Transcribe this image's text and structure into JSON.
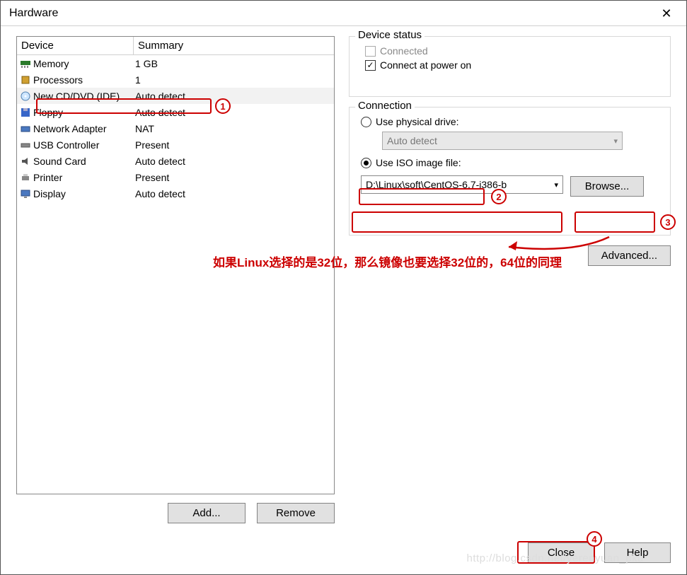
{
  "window": {
    "title": "Hardware"
  },
  "device_table": {
    "headers": {
      "device": "Device",
      "summary": "Summary"
    },
    "rows": [
      {
        "name": "Memory",
        "summary": "1 GB",
        "icon": "memory"
      },
      {
        "name": "Processors",
        "summary": "1",
        "icon": "cpu"
      },
      {
        "name": "New CD/DVD (IDE)",
        "summary": "Auto detect",
        "icon": "cd",
        "selected": true
      },
      {
        "name": "Floppy",
        "summary": "Auto detect",
        "icon": "floppy"
      },
      {
        "name": "Network Adapter",
        "summary": "NAT",
        "icon": "net"
      },
      {
        "name": "USB Controller",
        "summary": "Present",
        "icon": "usb"
      },
      {
        "name": "Sound Card",
        "summary": "Auto detect",
        "icon": "sound"
      },
      {
        "name": "Printer",
        "summary": "Present",
        "icon": "printer"
      },
      {
        "name": "Display",
        "summary": "Auto detect",
        "icon": "display"
      }
    ]
  },
  "buttons": {
    "add": "Add...",
    "remove": "Remove",
    "browse": "Browse...",
    "advanced": "Advanced...",
    "close": "Close",
    "help": "Help"
  },
  "device_status": {
    "legend": "Device status",
    "connected": "Connected",
    "connect_power_on": "Connect at power on"
  },
  "connection": {
    "legend": "Connection",
    "use_physical": "Use physical drive:",
    "physical_value": "Auto detect",
    "use_iso": "Use ISO image file:",
    "iso_value": "D:\\Linux\\soft\\CentOS-6.7-i386-b"
  },
  "annotations": {
    "n1": "1",
    "n2": "2",
    "n3": "3",
    "n4": "4",
    "note": "如果Linux选择的是32位，那么镜像也要选择32位的，64位的同理"
  },
  "watermark": "http://blog.csdn.net/yerenyuan_pku"
}
